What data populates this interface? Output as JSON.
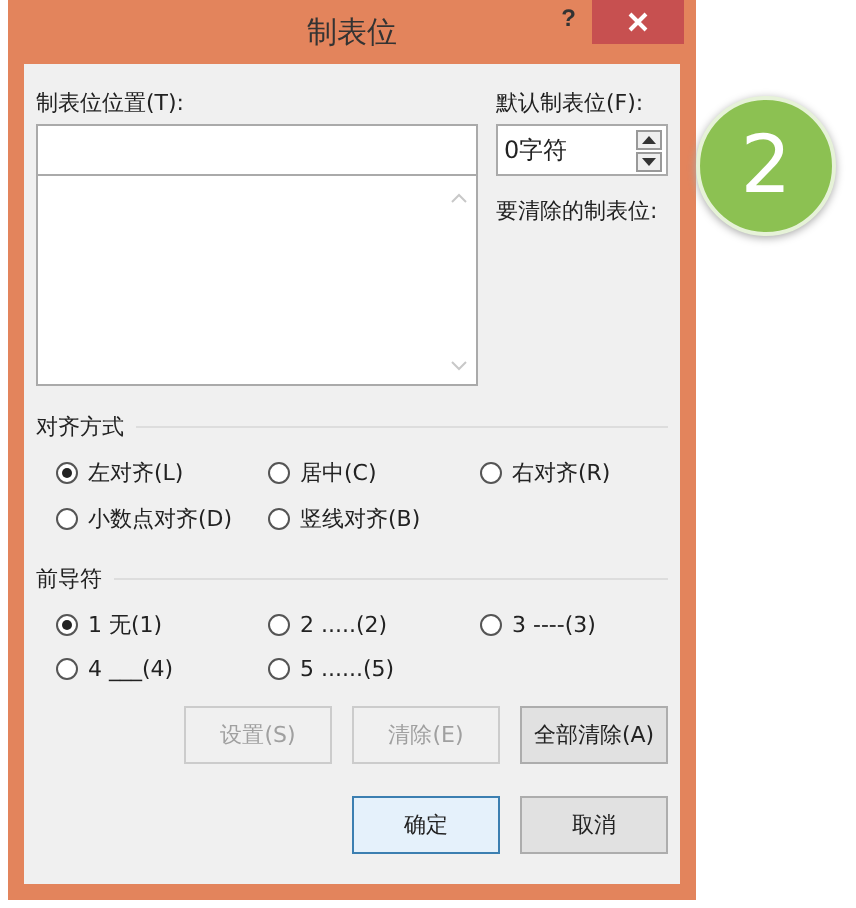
{
  "window": {
    "title": "制表位",
    "help": "?"
  },
  "tab_position": {
    "label": "制表位位置(T):"
  },
  "default_tab": {
    "label": "默认制表位(F):",
    "value": "0字符"
  },
  "clear_label": "要清除的制表位:",
  "alignment": {
    "title": "对齐方式",
    "options": [
      {
        "label": "左对齐(L)",
        "selected": true
      },
      {
        "label": "居中(C)",
        "selected": false
      },
      {
        "label": "右对齐(R)",
        "selected": false
      },
      {
        "label": "小数点对齐(D)",
        "selected": false
      },
      {
        "label": "竖线对齐(B)",
        "selected": false
      }
    ]
  },
  "leader": {
    "title": "前导符",
    "options": [
      {
        "label": "1 无(1)",
        "selected": true
      },
      {
        "label": "2 .....(2)",
        "selected": false
      },
      {
        "label": "3 ----(3)",
        "selected": false
      },
      {
        "label": "4 ___(4)",
        "selected": false
      },
      {
        "label": "5 ......(5)",
        "selected": false
      }
    ]
  },
  "action_buttons": [
    {
      "label": "设置(S)",
      "disabled": true
    },
    {
      "label": "清除(E)",
      "disabled": true
    },
    {
      "label": "全部清除(A)",
      "disabled": false
    }
  ],
  "buttons": [
    {
      "label": "确定",
      "default": true
    },
    {
      "label": "取消",
      "default": false
    }
  ],
  "step_badge": "2"
}
